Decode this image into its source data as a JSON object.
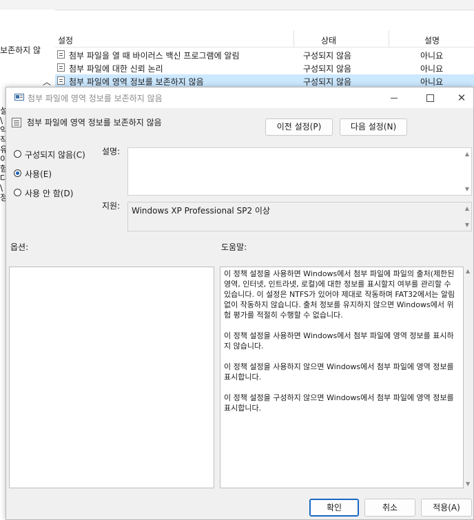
{
  "background": {
    "left_title": "보존하지 않",
    "left_fragments": [
      "설",
      "\\",
      "약",
      "작",
      "유",
      "이",
      "험",
      "다",
      "",
      "\\",
      "정"
    ],
    "columns": {
      "setting": "설정",
      "state": "상태",
      "comment": "설명"
    },
    "rows": [
      {
        "name": "첨부 파일을 열 때 바이러스 백신 프로그램에 알림",
        "state": "구성되지 않음",
        "comment": "아니요"
      },
      {
        "name": "첨부 파일에 대한 신뢰 논리",
        "state": "구성되지 않음",
        "comment": "아니요"
      },
      {
        "name": "첨부 파일에 영역 정보를 보존하지 않음",
        "state": "구성되지 않음",
        "comment": "아니요"
      }
    ]
  },
  "dialog": {
    "window_title": "첨부 파일에 영역 정보를 보존하지 않음",
    "policy_title": "첨부 파일에 영역 정보를 보존하지 않음",
    "prev_button": "이전 설정(P)",
    "next_button": "다음 설정(N)",
    "radios": [
      {
        "label": "구성되지 않음(C)",
        "selected": false
      },
      {
        "label": "사용(E)",
        "selected": true
      },
      {
        "label": "사용 안 함(D)",
        "selected": false
      }
    ],
    "description_label": "설명:",
    "description_value": "",
    "supported_label": "지원:",
    "supported_value": "Windows XP Professional SP2 이상",
    "options_label": "옵션:",
    "help_label": "도움말:",
    "help_text": "이 정책 설정을 사용하면 Windows에서 첨부 파일에 파일의 출처(제한된 영역, 인터넷, 인트라넷, 로컬)에 대한 정보를 표시할지 여부를 관리할 수 있습니다. 이 설정은 NTFS가 있어야 제대로 작동하며 FAT32에서는 알림 없이 작동하지 않습니다. 출처 정보를 유지하지 않으면 Windows에서 위험 평가를 적절히 수행할 수 없습니다.\n\n이 정책 설정을 사용하면 Windows에서 첨부 파일에 영역 정보를 표시하지 않습니다.\n\n이 정책 설정을 사용하지 않으면 Windows에서 첨부 파일에 영역 정보를 표시합니다.\n\n이 정책 설정을 구성하지 않으면 Windows에서 첨부 파일에 영역 정보를 표시합니다.",
    "ok_button": "확인",
    "cancel_button": "취소",
    "apply_button": "적용(A)",
    "icons": {
      "title": "policy-icon",
      "minimize": "minimize-icon",
      "maximize": "maximize-icon",
      "close": "close-icon"
    },
    "accent_color": "#1a66c2"
  }
}
